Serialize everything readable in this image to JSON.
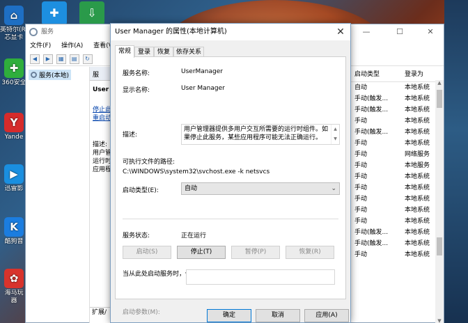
{
  "desktop": {
    "icons": [
      {
        "label": "英特尔(R)",
        "label2": "芯显卡",
        "glyph": "⌂",
        "color": "#1e6fc4"
      },
      {
        "label": "360安全",
        "glyph": "✚",
        "color": "#2fae3c"
      },
      {
        "label": "Yande",
        "glyph": "Y",
        "color": "#d62b2b"
      },
      {
        "label": "迅雷影",
        "glyph": "▶",
        "color": "#1a8fe0"
      },
      {
        "label": "酷狗音",
        "glyph": "K",
        "color": "#1b7de0"
      },
      {
        "label": "海马玩",
        "label2": "器",
        "glyph": "✿",
        "color": "#d8332c"
      }
    ]
  },
  "services_window": {
    "title": "服务",
    "menu": [
      "文件(F)",
      "操作(A)",
      "查看(V)"
    ],
    "tree_item": "服务(本地)",
    "mid_pane": {
      "header": "服",
      "service_name_cut": "User I",
      "stop_link": "停止此",
      "restart_link": "重启动",
      "desc_label": "描述:",
      "desc_lines": [
        "用户管",
        "运行时",
        "应用程"
      ],
      "tab_expand": "扩展",
      "tab_std": "/"
    },
    "columns": {
      "startup_type": "启动类型",
      "logon_as": "登录为"
    },
    "rows": [
      {
        "startup": "自动",
        "logon": "本地系统"
      },
      {
        "startup": "手动(触发...",
        "logon": "本地系统"
      },
      {
        "startup": "手动(触发...",
        "logon": "本地系统"
      },
      {
        "startup": "手动",
        "logon": "本地系统"
      },
      {
        "startup": "手动(触发...",
        "logon": "本地系统"
      },
      {
        "startup": "手动",
        "logon": "本地系统"
      },
      {
        "startup": "手动",
        "logon": "网络服务"
      },
      {
        "startup": "手动",
        "logon": "本地服务"
      },
      {
        "startup": "手动",
        "logon": "本地系统"
      },
      {
        "startup": "手动",
        "logon": "本地系统"
      },
      {
        "startup": "手动",
        "logon": "本地系统"
      },
      {
        "startup": "手动",
        "logon": "本地系统"
      },
      {
        "startup": "手动",
        "logon": "本地系统"
      },
      {
        "startup": "手动(触发...",
        "logon": "本地系统"
      },
      {
        "startup": "手动(触发...",
        "logon": "本地系统"
      },
      {
        "startup": "手动",
        "logon": "本地系统"
      }
    ]
  },
  "dialog": {
    "title": "User Manager 的属性(本地计算机)",
    "close_glyph": "✕",
    "tabs": [
      "常规",
      "登录",
      "恢复",
      "依存关系"
    ],
    "service_name_label": "服务名称:",
    "service_name": "UserManager",
    "display_name_label": "显示名称:",
    "display_name": "User Manager",
    "description_label": "描述:",
    "description": "用户管理器提供多用户交互所需要的运行时组件。如果停止此服务，某些应用程序可能无法正确运行。",
    "exe_path_label": "可执行文件的路径:",
    "exe_path": "C:\\WINDOWS\\system32\\svchost.exe -k netsvcs",
    "startup_type_label": "启动类型(E):",
    "startup_type_value": "自动",
    "status_label": "服务状态:",
    "status_value": "正在运行",
    "btn_start": "启动(S)",
    "btn_stop": "停止(T)",
    "btn_pause": "暂停(P)",
    "btn_resume": "恢复(R)",
    "hint": "当从此处启动服务时，你可指定所适用的启动参数。",
    "start_params_label": "启动参数(M):",
    "start_params_value": "",
    "ok": "确定",
    "cancel": "取消",
    "apply": "应用(A)"
  }
}
